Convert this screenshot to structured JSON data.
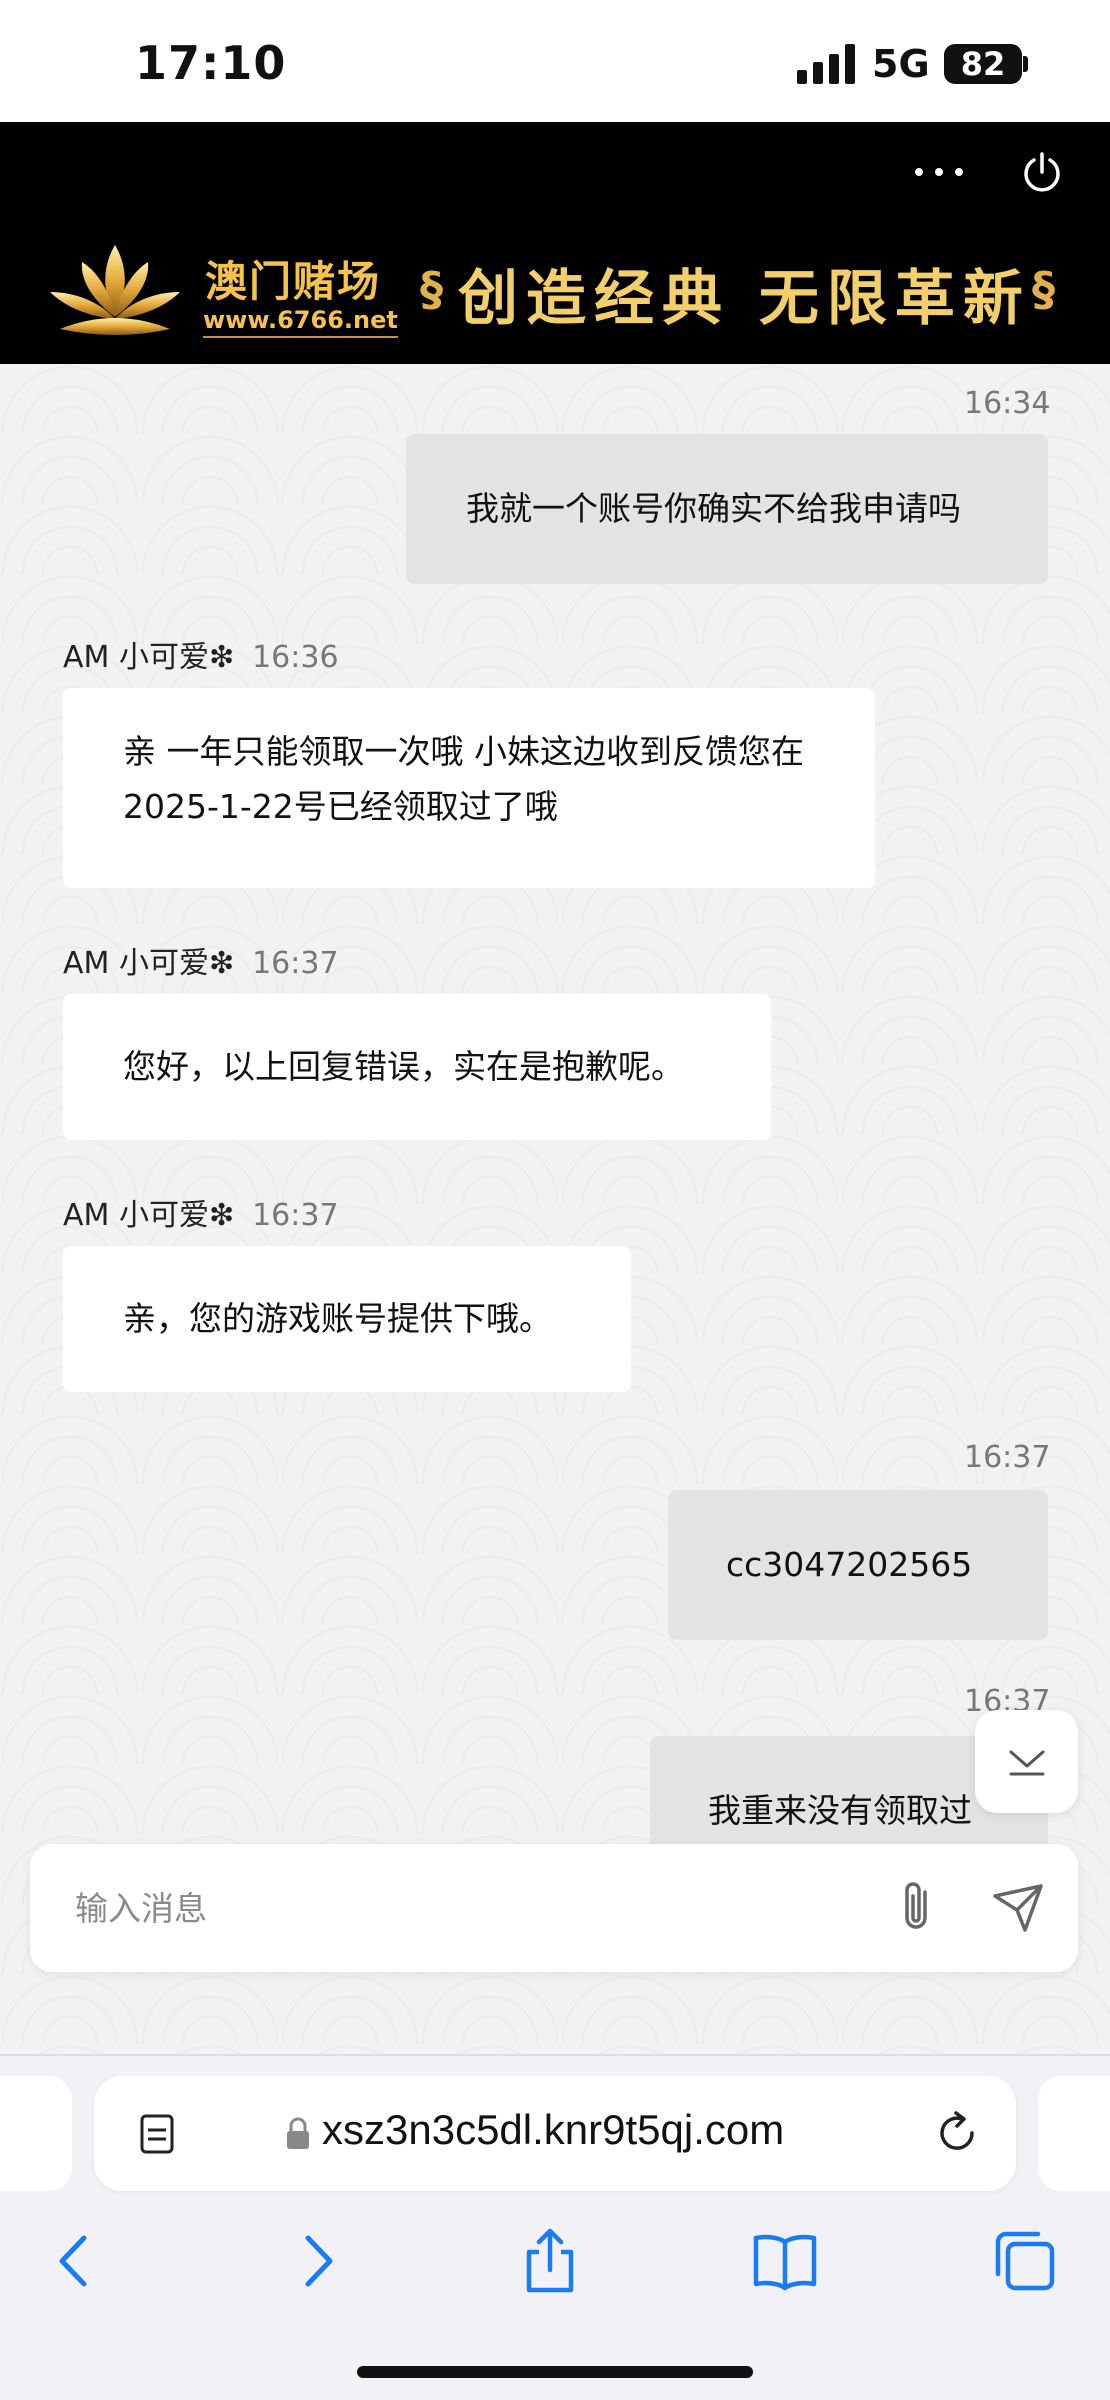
{
  "status_bar": {
    "time": "17:10",
    "network": "5G",
    "battery": "82"
  },
  "banner": {
    "brand_title": "澳门赌场",
    "brand_url": "www.6766.net",
    "slogan": "创造经典  无限革新"
  },
  "chat": {
    "messages": [
      {
        "direction": "out",
        "time": "16:34",
        "text": "我就一个账号你确实不给我申请吗"
      },
      {
        "direction": "in",
        "sender": "AM 小可爱❇",
        "time": "16:36",
        "text": "亲 一年只能领取一次哦 小妹这边收到反馈您在 2025-1-22号已经领取过了哦"
      },
      {
        "direction": "in",
        "sender": "AM 小可爱❇",
        "time": "16:37",
        "text": "您好，以上回复错误，实在是抱歉呢。"
      },
      {
        "direction": "in",
        "sender": "AM 小可爱❇",
        "time": "16:37",
        "text": "亲，您的游戏账号提供下哦。"
      },
      {
        "direction": "out",
        "time": "16:37",
        "text": "cc3047202565"
      },
      {
        "direction": "out",
        "time": "16:37",
        "text": "我重来没有领取过"
      }
    ]
  },
  "composer": {
    "placeholder": "输入消息"
  },
  "browser": {
    "url": "xsz3n3c5dl.knr9t5qj.com"
  },
  "colors": {
    "outgoing_bubble": "#e3e3e5",
    "incoming_bubble": "#ffffff",
    "ios_blue": "#1a7cf5",
    "banner_gold": "#f5c24c"
  }
}
